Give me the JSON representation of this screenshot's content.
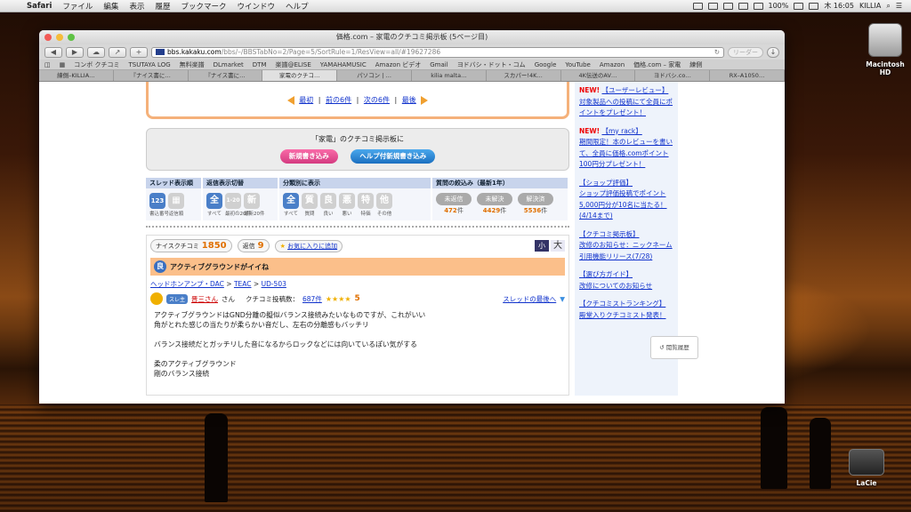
{
  "menubar": {
    "app": "Safari",
    "menus": [
      "ファイル",
      "編集",
      "表示",
      "履歴",
      "ブックマーク",
      "ウインドウ",
      "ヘルプ"
    ],
    "battery": "100%",
    "clock": "木 16:05",
    "user": "KILLIA"
  },
  "desktop": {
    "hd_label": "Macintosh HD",
    "lacie_label": "LaCie"
  },
  "window": {
    "title": "価格.com – 家電のクチコミ掲示板 (5ページ目)",
    "url_domain": "bbs.kakaku.com",
    "url_path": "/bbs/–/BBSTabNo=2/Page=5/SortRule=1/ResView=all/#19627286",
    "reader_label": "リーダー"
  },
  "bookmarks": [
    "コンボ クチコミ",
    "TSUTAYA LOG",
    "無料楽譜",
    "DLmarket",
    "DTM",
    "楽譜@ELISE",
    "YAMAHAMUSIC",
    "Amazon ビデオ",
    "Gmail",
    "ヨドバシ・ドット・コム",
    "Google",
    "YouTube",
    "Amazon",
    "価格.com – 家電",
    "練側"
  ],
  "tabs": [
    "練側–KILLIA…",
    "『ナイス書に…",
    "『ナイス書に…",
    "家電のクチコ…",
    "パソコン | …",
    "kilia malta…",
    "スカパー!4K…",
    "4K伝送のAV…",
    "ヨドバシ.co…",
    "RX–A1050…"
  ],
  "pager": {
    "first": "最初",
    "prev": "前の6件",
    "next": "次の6件",
    "last": "最後",
    "sep": "|"
  },
  "postbox": {
    "heading": "「家電」のクチコミ掲示板に",
    "new_post": "新規書き込み",
    "help_post": "ヘルプ付新規書き込み"
  },
  "filters": {
    "thread_view": {
      "title": "スレッド表示順",
      "buttons": [
        {
          "icon": "123",
          "label": "書込番号"
        },
        {
          "icon": "▦",
          "label": "返信順"
        }
      ]
    },
    "reply_view": {
      "title": "返信表示切替",
      "buttons": [
        {
          "icon": "全",
          "label": "すべて"
        },
        {
          "icon": "1-20",
          "label": "最初の20件"
        },
        {
          "icon": "新",
          "label": "最新20件"
        }
      ]
    },
    "category": {
      "title": "分類別に表示",
      "buttons": [
        {
          "icon": "全",
          "label": "すべて"
        },
        {
          "icon": "質",
          "label": "質問"
        },
        {
          "icon": "良",
          "label": "良い"
        },
        {
          "icon": "悪",
          "label": "悪い"
        },
        {
          "icon": "特",
          "label": "特価"
        },
        {
          "icon": "他",
          "label": "その他"
        }
      ]
    },
    "questions": {
      "title": "質問の絞込み（最新1年）",
      "buttons": [
        {
          "label": "未返信",
          "count": "472",
          "unit": "件"
        },
        {
          "label": "未解決",
          "count": "4429",
          "unit": "件"
        },
        {
          "label": "解決済",
          "count": "5536",
          "unit": "件"
        }
      ]
    }
  },
  "thread": {
    "nice_label": "ナイスクチコミ",
    "nice_count": "1850",
    "reply_label": "返信",
    "reply_count": "9",
    "fav_label": "お気に入りに追加",
    "size_small": "小",
    "size_large": "大",
    "category_icon": "良",
    "title": "アクティブグラウンドがイイね",
    "crumb_1": "ヘッドホンアンプ・DAC",
    "crumb_2": "TEAC",
    "crumb_3": "UD-503",
    "crumb_sep": ">",
    "sure_badge": "スレ主",
    "user": "晋三さん",
    "honorific": "さん",
    "post_count_label": "クチコミ投稿数：",
    "post_count": "687件",
    "rank": "5",
    "to_end": "スレッドの最後へ",
    "body": [
      "アクティブグラウンドはGND分離の擬似バランス接続みたいなものですが、これがいい",
      "角がとれた感じの当たりが柔らかい音だし、左右の分離感もバッチリ",
      "",
      "バランス接続だとガッチリした音になるからロックなどには向いているぽい気がする",
      "",
      "柔のアクティブグラウンド",
      "剛のバランス接続"
    ]
  },
  "sidebar": [
    {
      "flag": "NEW!",
      "title": "【ユーザーレビュー】",
      "text": "対象製品への投稿にて全員にポイントをプレゼント！"
    },
    {
      "flag": "NEW!",
      "title": "【my rack】",
      "text": "期間限定！本のレビューを書いて、全員に価格.comポイント100円分プレゼント！"
    },
    {
      "flag": "",
      "title": "【ショップ評価】",
      "text": "ショップ評価投稿でポイント5,000円分が10名に当たる！(4/14まで)"
    },
    {
      "flag": "",
      "title": "【クチコミ掲示板】",
      "text": "改修のお知らせ：ニックネーム引用機能リリース(7/28)"
    },
    {
      "flag": "",
      "title": "【選び方ガイド】",
      "text": "改修についてのお知らせ"
    },
    {
      "flag": "",
      "title": "【クチコミストランキング】",
      "text": "殿堂入りクチコミスト発表！"
    }
  ],
  "history_button": "閲覧履歴",
  "colors": {
    "accent_orange": "#f5b17a",
    "link": "#1133cc",
    "count_orange": "#e07000",
    "new_red": "#e00000"
  }
}
